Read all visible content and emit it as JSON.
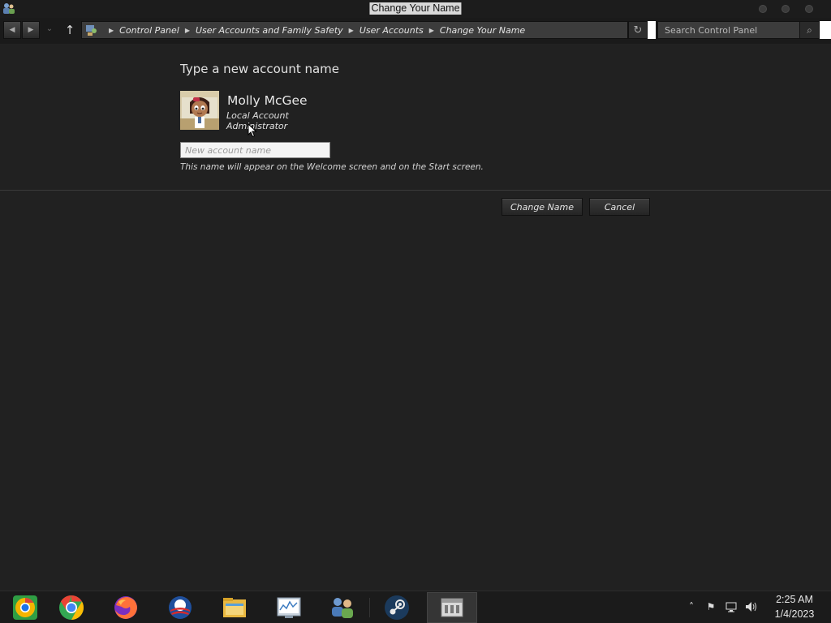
{
  "window": {
    "title": "Change Your Name"
  },
  "breadcrumb": {
    "items": [
      "Control Panel",
      "User Accounts and Family Safety",
      "User Accounts",
      "Change Your Name"
    ]
  },
  "search": {
    "placeholder": "Search Control Panel"
  },
  "main": {
    "heading": "Type a new account name",
    "user_name": "Molly McGee",
    "account_type": "Local Account",
    "account_role": "Administrator",
    "name_input_placeholder": "New account name",
    "name_input_value": "",
    "hint": "This name will appear on the Welcome screen and on the Start screen."
  },
  "buttons": {
    "change_name": "Change Name",
    "cancel": "Cancel"
  },
  "taskbar": {
    "apps": [
      "chrome-canary-icon",
      "chrome-icon",
      "firefox-icon",
      "obama-logo-icon",
      "file-explorer-icon",
      "performance-monitor-icon",
      "user-accounts-icon",
      "steam-icon",
      "control-panel-icon"
    ]
  },
  "clock": {
    "time": "2:25 AM",
    "date": "1/4/2023"
  },
  "colors": {
    "background": "#212121",
    "taskbar": "#1b1b1b",
    "text": "#e2e2e2"
  }
}
